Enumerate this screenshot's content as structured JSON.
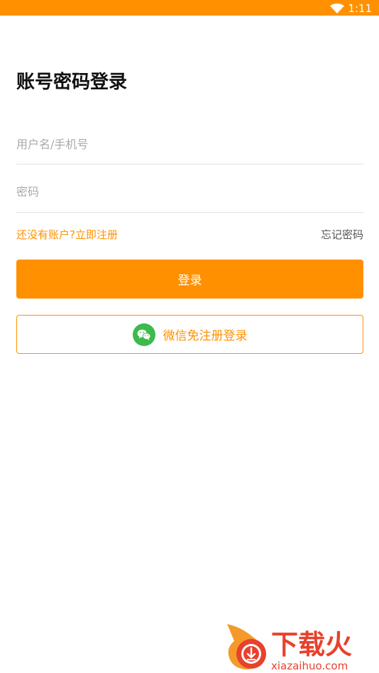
{
  "status_bar": {
    "time": "1:11",
    "wifi_icon": "wifi-icon",
    "color": "#FF9100"
  },
  "page": {
    "title": "账号密码登录"
  },
  "form": {
    "username_placeholder": "用户名/手机号",
    "username_value": "",
    "password_placeholder": "密码",
    "password_value": ""
  },
  "links": {
    "register": "还没有账户?立即注册",
    "forgot_password": "忘记密码"
  },
  "buttons": {
    "login": "登录",
    "wechat_login": "微信免注册登录",
    "wechat_icon": "wechat-icon"
  },
  "watermark": {
    "brand": "下载火",
    "domain": "xiazaihuo.com"
  },
  "colors": {
    "accent": "#FF9100",
    "wechat_green": "#3DBA4E",
    "watermark_red": "#E8412C"
  }
}
